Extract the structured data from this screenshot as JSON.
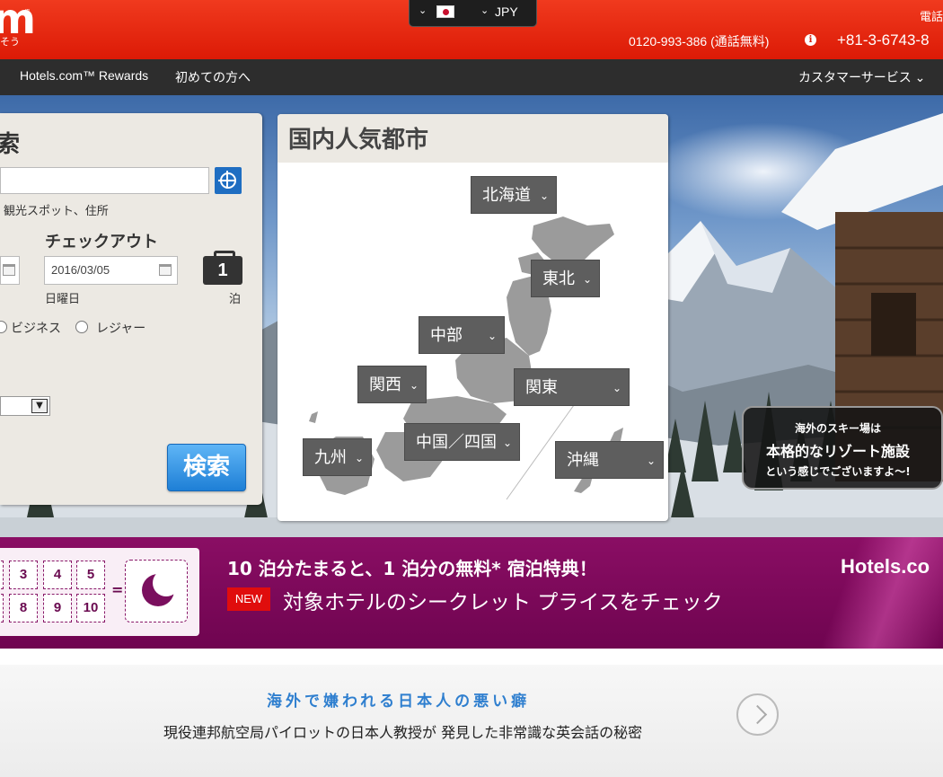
{
  "header": {
    "logo_mark": "m",
    "logo_tm": "™",
    "logo_subtext": "そう",
    "flag_icon": "japan-flag-icon",
    "currency": "JPY",
    "phone_label": "電話",
    "phone_free": "0120-993-386 (通話無料)",
    "phone_intl": "+81-3-6743-8"
  },
  "nav": {
    "rewards": "Hotels.com™ Rewards",
    "first_time": "初めての方へ",
    "customer_service": "カスタマーサービス ⌄"
  },
  "search": {
    "title": "索",
    "destination_hint": "観光スポット、住所",
    "checkout_label": "チェックアウト",
    "checkout_date": "2016/03/05",
    "checkout_day": "日曜日",
    "nights": "1",
    "nights_unit": "泊",
    "trip_business": "ビジネス",
    "trip_leisure": "レジャー",
    "submit": "検索"
  },
  "popular": {
    "title": "国内人気都市",
    "regions": [
      "北海道",
      "東北",
      "中部",
      "関西",
      "関東",
      "中国／四国",
      "九州",
      "沖縄"
    ]
  },
  "ski_badge": {
    "line1": "海外のスキー場は",
    "line2": "本格的なリゾート施設",
    "line3": "という感じでございますよ〜!"
  },
  "rewards": {
    "stamps": [
      "3",
      "4",
      "5",
      "8",
      "9",
      "10"
    ],
    "equals": "=",
    "headline": "10 泊分たまると、1 泊分の無料* 宿泊特典！",
    "new_badge": "NEW",
    "subline": "対象ホテルのシークレット プライスをチェック",
    "brand": "Hotels.co"
  },
  "ad": {
    "title": "海外で嫌われる日本人の悪い癖",
    "subtitle": "現役連邦航空局パイロットの日本人教授が 発見した非常識な英会話の秘密"
  },
  "colors": {
    "header_red": "#e02a10",
    "nav_dark": "#2d2d2d",
    "rewards_purple": "#7a0a5a",
    "search_blue": "#1e7fd6"
  }
}
